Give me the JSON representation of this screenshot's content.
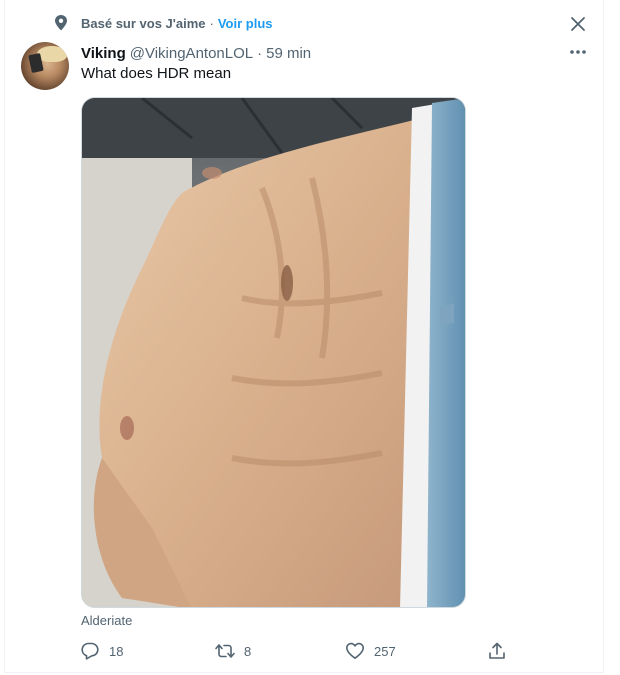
{
  "context": {
    "label": "Basé sur vos J'aime",
    "separator": "·",
    "see_more": "Voir plus",
    "icon": "location-pin-icon"
  },
  "tweet": {
    "display_name": "Viking",
    "handle": "@VikingAntonLOL",
    "separator": "·",
    "time": "59 min",
    "text": "What does HDR mean",
    "media_caption": "Alderiate",
    "avatar_icon": "avatar-image"
  },
  "actions": {
    "replies": "18",
    "retweets": "8",
    "likes": "257",
    "reply_icon": "reply-icon",
    "retweet_icon": "retweet-icon",
    "like_icon": "heart-icon",
    "share_icon": "share-icon"
  },
  "colors": {
    "text_primary": "#0f1419",
    "text_secondary": "#536471",
    "accent": "#1d9bf0",
    "border": "#cfd9de"
  }
}
